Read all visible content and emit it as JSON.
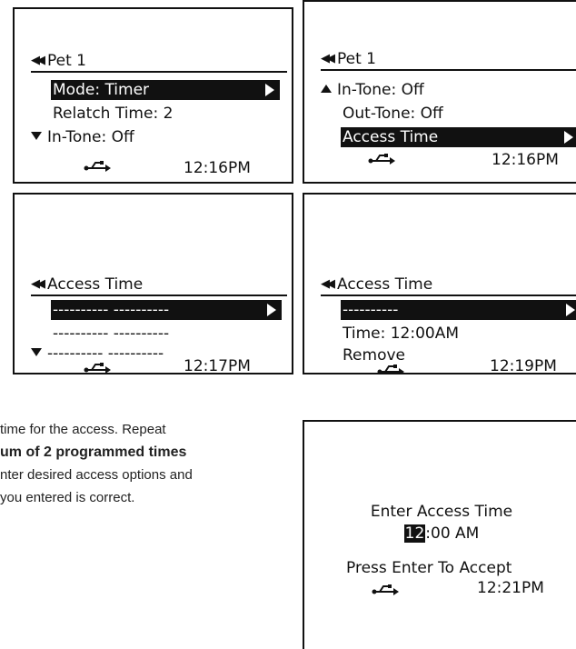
{
  "screens": [
    {
      "header": "Pet 1",
      "rows": [
        "Mode: Timer",
        "Relatch Time: 2",
        "In-Tone: Off"
      ],
      "clock": "12:16PM"
    },
    {
      "header": "Pet 1",
      "rows": [
        "In-Tone: Off",
        "Out-Tone: Off",
        "Access Time"
      ],
      "clock": "12:16PM"
    },
    {
      "header": "Access Time",
      "rows": [
        "---------- ----------",
        "---------- ----------",
        "---------- ----------"
      ],
      "clock": "12:17PM"
    },
    {
      "header": "Access Time",
      "rows": [
        "----------",
        "Time: 12:00AM",
        "Remove"
      ],
      "clock": "12:19PM"
    },
    {
      "title": "Enter Access Time",
      "hour": "12",
      "rest": ":00 AM",
      "prompt": "Press Enter To Accept",
      "clock": "12:21PM"
    }
  ],
  "description": {
    "line1": "time for the access. Repeat",
    "line2_bold": "um of 2 programmed times",
    "line3": "nter desired access options and",
    "line4": "you entered is correct."
  },
  "icons": {
    "back": "double-left-arrow-icon",
    "usb": "usb-icon"
  }
}
